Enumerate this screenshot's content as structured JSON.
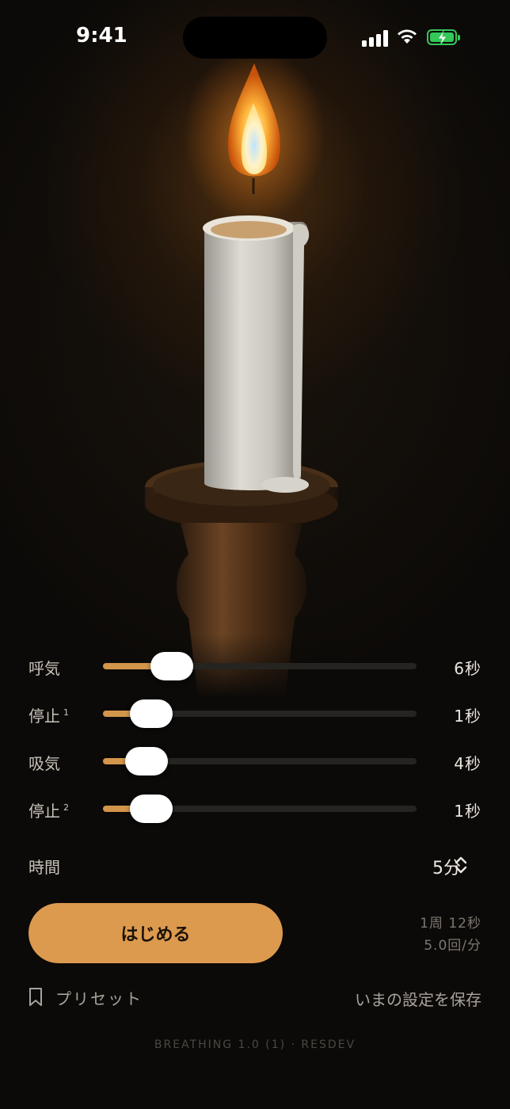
{
  "status_bar": {
    "time": "9:41"
  },
  "controls": [
    {
      "label": "呼気",
      "sup": "",
      "value_text": "6秒",
      "level": 0.22
    },
    {
      "label": "停止",
      "sup": "1",
      "value_text": "1秒",
      "level": 0.155
    },
    {
      "label": "吸気",
      "sup": "",
      "value_text": "4秒",
      "level": 0.14
    },
    {
      "label": "停止",
      "sup": "2",
      "value_text": "1秒",
      "level": 0.155
    }
  ],
  "duration": {
    "label": "時間",
    "value": "5分"
  },
  "start_button": {
    "label": "はじめる"
  },
  "cycle_info": {
    "cycle": "1周 12秒",
    "rate": "5.0回/分"
  },
  "preset": {
    "label": "プリセット"
  },
  "save": {
    "label": "いまの設定を保存"
  },
  "footer": "BREATHING 1.0 (1) · RESDEV",
  "colors": {
    "accent": "#dc9a4e",
    "background": "#0c0a08",
    "battery": "#34c759"
  },
  "icons": [
    "signal-icon",
    "wifi-icon",
    "battery-icon",
    "chevron-updown-icon",
    "bookmark-icon"
  ]
}
